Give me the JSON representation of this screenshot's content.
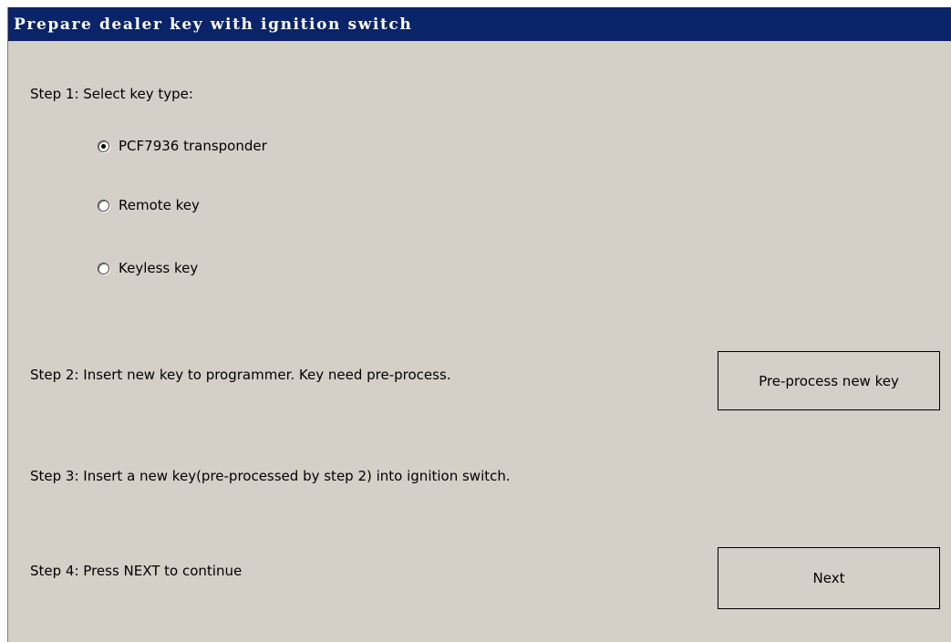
{
  "window": {
    "title": "Prepare dealer key with ignition switch"
  },
  "step1": {
    "label": "Step 1: Select key type:",
    "options": [
      {
        "label": "PCF7936 transponder",
        "checked": true
      },
      {
        "label": "Remote key",
        "checked": false
      },
      {
        "label": "Keyless key",
        "checked": false
      }
    ]
  },
  "step2": {
    "label": "Step 2: Insert new key to programmer. Key need pre-process.",
    "button_label": "Pre-process new key"
  },
  "step3": {
    "label": "Step 3: Insert a new key(pre-processed by step 2) into ignition switch."
  },
  "step4": {
    "label": "Step 4: Press NEXT to continue",
    "button_label": "Next"
  },
  "colors": {
    "titlebar": "#0a246a",
    "background": "#d4d0c8"
  }
}
